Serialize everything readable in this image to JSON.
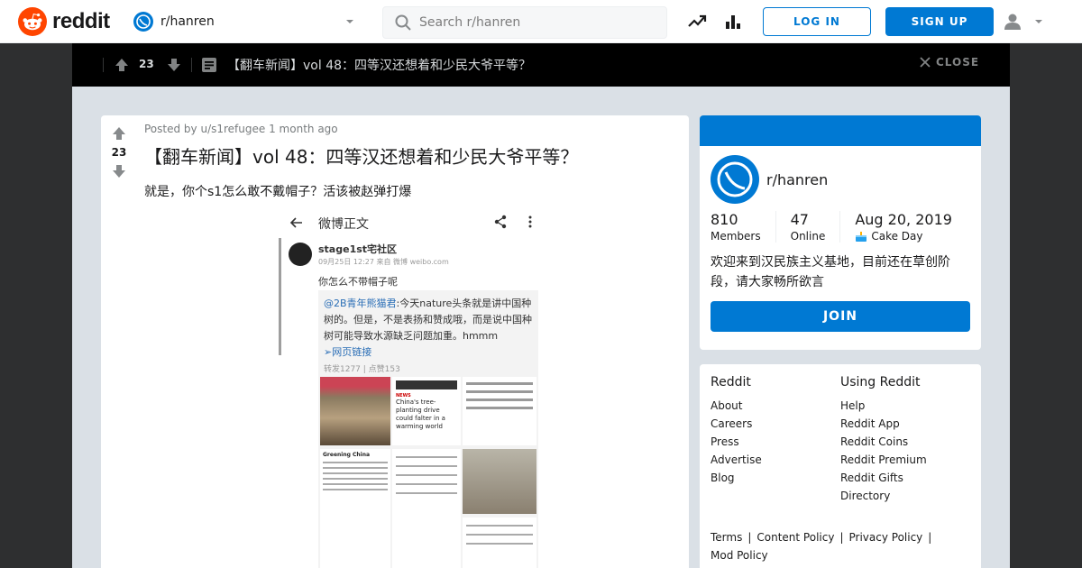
{
  "header": {
    "logo_text": "reddit",
    "community": "r/hanren",
    "search_placeholder": "Search r/hanren",
    "login_label": "LOG IN",
    "signup_label": "SIGN UP",
    "brand_color": "#ff4500",
    "accent_color": "#0079d3"
  },
  "post_bar": {
    "score": "23",
    "title": "【翻车新闻】vol 48：四等汉还想着和少民大爷平等？",
    "close_label": "CLOSE"
  },
  "post": {
    "posted_by_prefix": "Posted by",
    "author": "u/s1refugee",
    "time": "1 month ago",
    "score": "23",
    "title": "【翻车新闻】vol 48：四等汉还想着和少民大爷平等？",
    "body": "就是，你个s1怎么敢不戴帽子？活该被赵弹打爆",
    "image": {
      "header": "微博正文",
      "account": "stage1st宅社区",
      "date": "09月25日 12:27 来自 微博 weibo.com",
      "comment": "你怎么不带帽子呢",
      "mention": "@2B青年熊猫君",
      "quote": ":今天nature头条就是讲中国种树的。但是，不是表扬和赞成哦，而是说中国种树可能导致水源缺乏问题加重。hmmm",
      "link": "网页链接",
      "counts": "转发1277 | 点赞153",
      "article_headline": "China's tree-planting drive could falter in a warming world",
      "article_section": "Greening China",
      "news_tag": "NEWS"
    }
  },
  "sidebar": {
    "name": "r/hanren",
    "members_value": "810",
    "members_label": "Members",
    "online_value": "47",
    "online_label": "Online",
    "cake_value": "Aug 20, 2019",
    "cake_label": "Cake Day",
    "description": "欢迎来到汉民族主义基地，目前还在草创阶段，请大家畅所欲言",
    "join_label": "JOIN"
  },
  "footer": {
    "col1_title": "Reddit",
    "col1": [
      "About",
      "Careers",
      "Press",
      "Advertise",
      "Blog"
    ],
    "col2_title": "Using Reddit",
    "col2": [
      "Help",
      "Reddit App",
      "Reddit Coins",
      "Reddit Premium",
      "Reddit Gifts",
      "Directory"
    ],
    "legal": [
      "Terms",
      "Content Policy",
      "Privacy Policy",
      "Mod Policy"
    ]
  }
}
